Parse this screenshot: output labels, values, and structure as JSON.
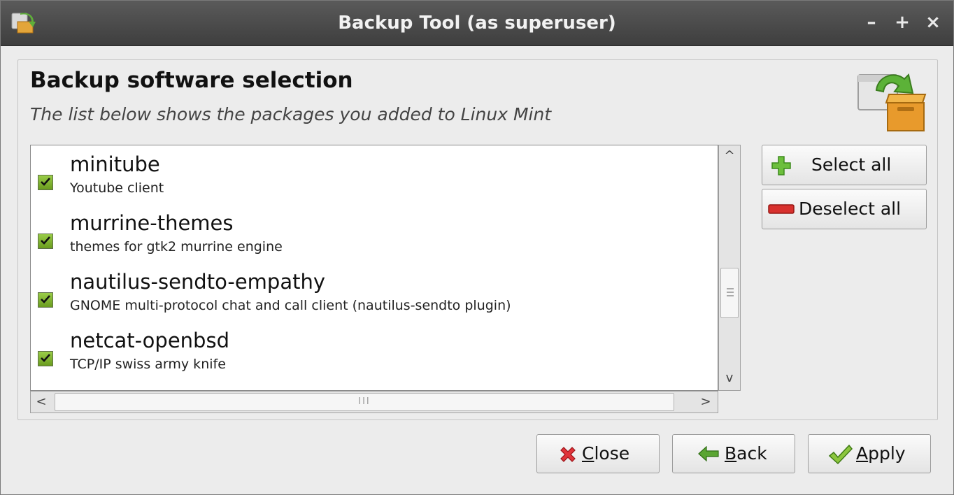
{
  "window": {
    "title": "Backup Tool (as superuser)",
    "controls": {
      "minimize": "–",
      "maximize": "+",
      "close": "×"
    }
  },
  "header": {
    "title": "Backup software selection",
    "subtitle": "The list below shows the packages you added to Linux Mint"
  },
  "packages": [
    {
      "name": "minitube",
      "description": "Youtube client",
      "checked": true
    },
    {
      "name": "murrine-themes",
      "description": "themes for gtk2 murrine engine",
      "checked": true
    },
    {
      "name": "nautilus-sendto-empathy",
      "description": "GNOME multi-protocol chat and call client (nautilus-sendto plugin)",
      "checked": true
    },
    {
      "name": "netcat-openbsd",
      "description": "TCP/IP swiss army knife",
      "checked": true
    }
  ],
  "side_buttons": {
    "select_all": "Select all",
    "deselect_all": "Deselect all"
  },
  "footer_buttons": {
    "close_mnemonic": "C",
    "close_rest": "lose",
    "back_mnemonic": "B",
    "back_rest": "ack",
    "apply_mnemonic": "A",
    "apply_rest": "pply"
  },
  "scrollbars": {
    "up": "^",
    "down": "v",
    "left": "<",
    "right": ">",
    "hgrip": "III"
  },
  "colors": {
    "titlebar": "#4a4a4a",
    "check_green": "#7fb536",
    "add_green": "#6cbf3c",
    "remove_red": "#d8312e",
    "close_red": "#e0343a",
    "back_green": "#5aa532"
  }
}
